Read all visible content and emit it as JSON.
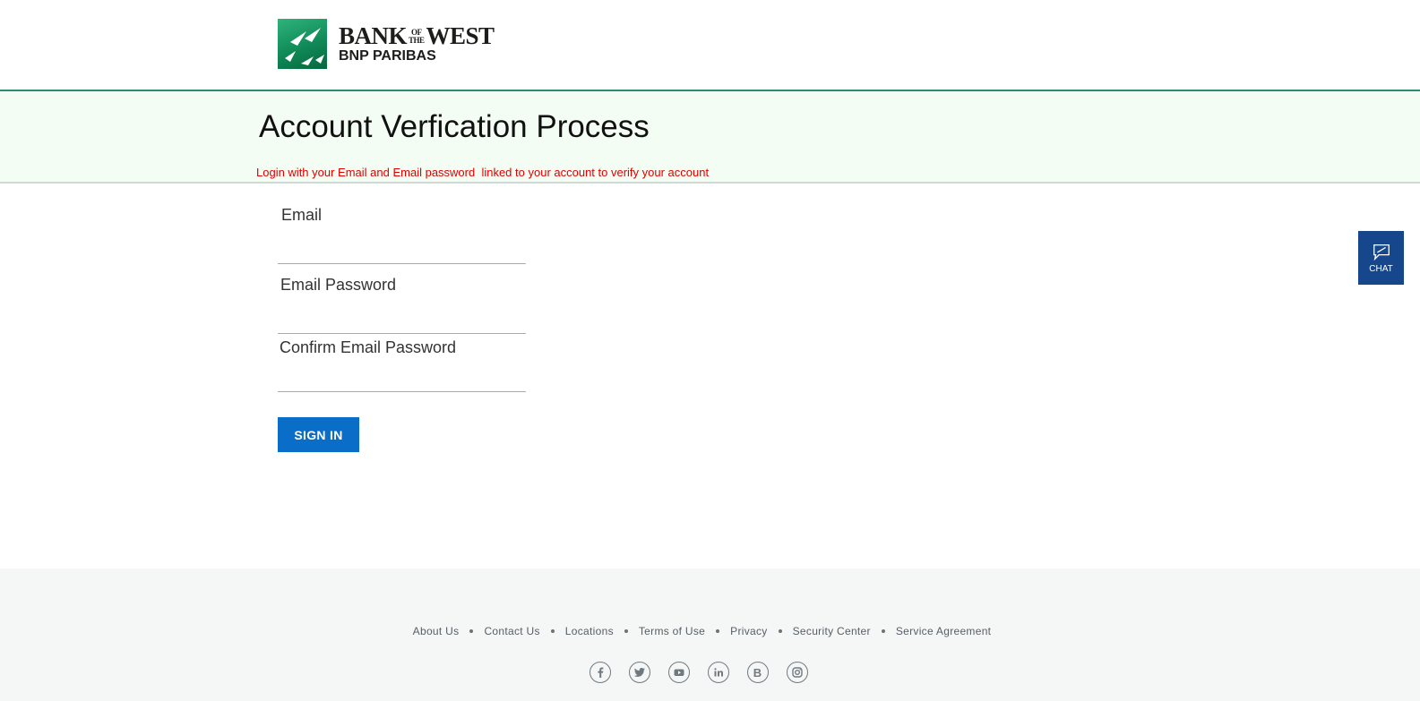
{
  "header": {
    "brand_line1_a": "BANK",
    "brand_of": "OF",
    "brand_the": "THE",
    "brand_line1_b": "WEST",
    "brand_line2": "BNP PARIBAS"
  },
  "banner": {
    "title": "Account Verfication Process",
    "notice": "Login with your Email and Email password  linked to your account to verify your account"
  },
  "form": {
    "email_label": "Email",
    "password_label": "Email Password",
    "confirm_label": "Confirm Email Password",
    "signin_label": "SIGN IN"
  },
  "chat": {
    "label": "CHAT"
  },
  "footer": {
    "links": [
      "About Us",
      "Contact Us",
      "Locations",
      "Terms of Use",
      "Privacy",
      "Security Center",
      "Service Agreement"
    ],
    "social_icons": [
      "facebook-icon",
      "twitter-icon",
      "youtube-icon",
      "linkedin-icon",
      "blog-icon",
      "instagram-icon"
    ],
    "blog_letter": "B"
  },
  "colors": {
    "brand_green": "#108a57",
    "band_bg": "#f4fdf4",
    "notice_red": "#e00000",
    "button_blue": "#0a6ec8",
    "chat_blue": "#16478d"
  }
}
